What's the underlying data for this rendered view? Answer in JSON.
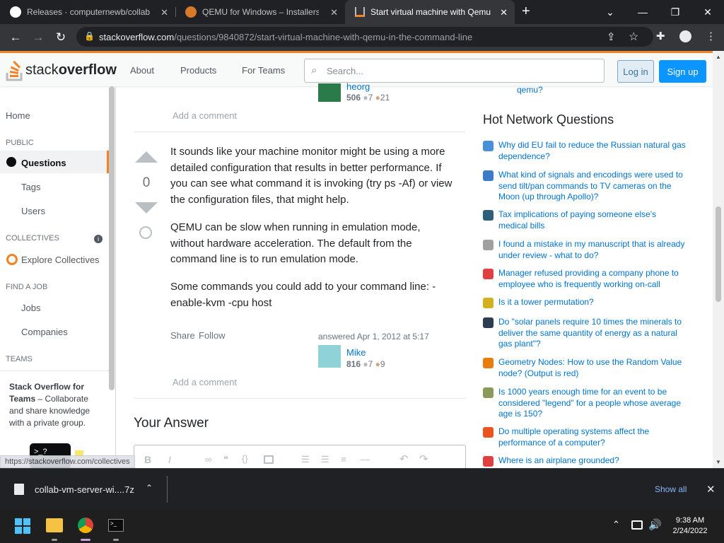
{
  "browser": {
    "tabs": [
      {
        "title": "Releases · computernewb/collab",
        "icon": "github-icon"
      },
      {
        "title": "QEMU for Windows – Installers (6",
        "icon": "qemu-icon"
      },
      {
        "title": "Start virtual machine with Qemu",
        "icon": "stackoverflow-icon"
      }
    ],
    "url_domain": "stackoverflow.com",
    "url_path": "/questions/9840872/start-virtual-machine-with-qemu-in-the-command-line"
  },
  "so": {
    "logo_a": "stack",
    "logo_b": "overflow",
    "nav": [
      "About",
      "Products",
      "For Teams"
    ],
    "search_placeholder": "Search...",
    "login": "Log in",
    "signup": "Sign up"
  },
  "sidebar": {
    "home": "Home",
    "public": "PUBLIC",
    "questions": "Questions",
    "tags": "Tags",
    "users": "Users",
    "collectives": "COLLECTIVES",
    "explore": "Explore Collectives",
    "findjob": "FIND A JOB",
    "jobs": "Jobs",
    "companies": "Companies",
    "teams": "TEAMS",
    "teams_title": "Stack Overflow for Teams",
    "teams_desc": "– Collaborate and share knowledge with a private group."
  },
  "prev_answer": {
    "user": "heorg",
    "rep": "506",
    "silver": "7",
    "bronze": "21",
    "add_comment": "Add a comment"
  },
  "answer": {
    "score": "0",
    "p1": "It sounds like your machine monitor might be using a more detailed configuration that results in better performance. If you can see what command it is invoking (try ps -Af) or view the configuration files, that might help.",
    "p2": "QEMU can be slow when running in emulation mode, without hardware acceleration. The default from the command line is to run emulation mode.",
    "p3": "Some commands you could add to your command line: -enable-kvm -cpu host",
    "share": "Share",
    "follow": "Follow",
    "answered": "answered Apr 1, 2012 at 5:17",
    "user": "Mike",
    "rep": "816",
    "silver": "7",
    "bronze": "9",
    "add_comment": "Add a comment"
  },
  "your_answer": "Your Answer",
  "right": {
    "prev_link": "qemu?",
    "hnq_title": "Hot Network Questions",
    "questions": [
      {
        "text": "Why did EU fail to reduce the Russian natural gas dependence?",
        "icon": "politics-icon",
        "color": "#4a90d9"
      },
      {
        "text": "What kind of signals and encodings were used to send tilt/pan commands to TV cameras on the Moon (up through Apollo)?",
        "icon": "space-exploration-icon",
        "color": "#3a7cc7"
      },
      {
        "text": "Tax implications of paying someone else's medical bills",
        "icon": "money-icon",
        "color": "#2e5f7a"
      },
      {
        "text": "I found a mistake in my manuscript that is already under review - what to do?",
        "icon": "academia-icon",
        "color": "#a0a0a0"
      },
      {
        "text": "Manager refused providing a company phone to employee who is frequently working on-call",
        "icon": "workplace-icon",
        "color": "#e04040"
      },
      {
        "text": "Is it a tower permutation?",
        "icon": "puzzling-icon",
        "color": "#d4b020"
      },
      {
        "text": "Do \"solar panels require 10 times the minerals to deliver the same quantity of energy as a natural gas plant\"?",
        "icon": "skeptics-icon",
        "color": "#2d3e50"
      },
      {
        "text": "Geometry Nodes: How to use the Random Value node? (Output is red)",
        "icon": "blender-icon",
        "color": "#e87d0d"
      },
      {
        "text": "Is 1000 years enough time for an event to be considered \"legend\" for a people whose average age is 150?",
        "icon": "worldbuilding-icon",
        "color": "#8a9a5b"
      },
      {
        "text": "Do multiple operating systems affect the performance of a computer?",
        "icon": "askubuntu-icon",
        "color": "#e95420"
      },
      {
        "text": "Where is an airplane grounded?",
        "icon": "aviation-icon",
        "color": "#e04040"
      }
    ]
  },
  "status_url": "https://stackoverflow.com/collectives",
  "download": {
    "file": "collab-vm-server-wi....7z",
    "show_all": "Show all"
  },
  "taskbar": {
    "time": "9:38 AM",
    "date": "2/24/2022"
  }
}
